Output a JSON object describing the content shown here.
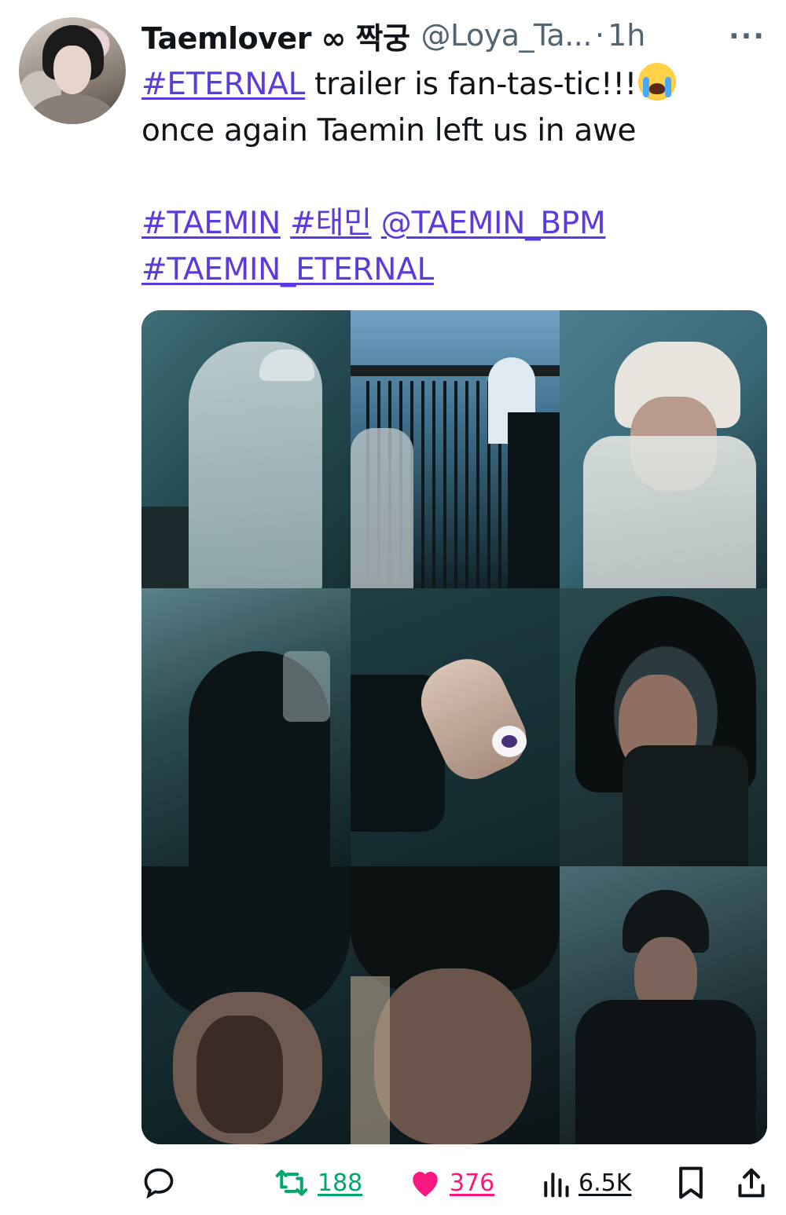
{
  "post": {
    "display_name": "Taemlover ∞ 짝궁",
    "handle": "@Loya_Ta...",
    "separator": "·",
    "time": "1h",
    "more": "···",
    "text": {
      "line1_hashtag": "#ETERNAL",
      "line1_rest": " trailer is fan-tas-tic!!!",
      "emoji": "loudly-crying-face",
      "line2": "once again Taemin left us in awe",
      "tag1": "#TAEMIN",
      "tag2": "#태민",
      "mention": "@TAEMIN_BPM",
      "tag3": "#TAEMIN_ETERNAL"
    },
    "media": {
      "count": 9,
      "layout": "3x3 grid"
    },
    "actions": {
      "reply_icon": "reply-icon",
      "repost_icon": "repost-icon",
      "repost_count": "188",
      "like_icon": "heart-icon",
      "like_count": "376",
      "views_icon": "views-icon",
      "views_count": "6.5K",
      "bookmark_icon": "bookmark-icon",
      "share_icon": "share-icon"
    }
  },
  "colors": {
    "link": "#5b3bdb",
    "repost": "#00a86b",
    "like": "#f91880",
    "muted": "#536471",
    "text": "#0f1419"
  }
}
